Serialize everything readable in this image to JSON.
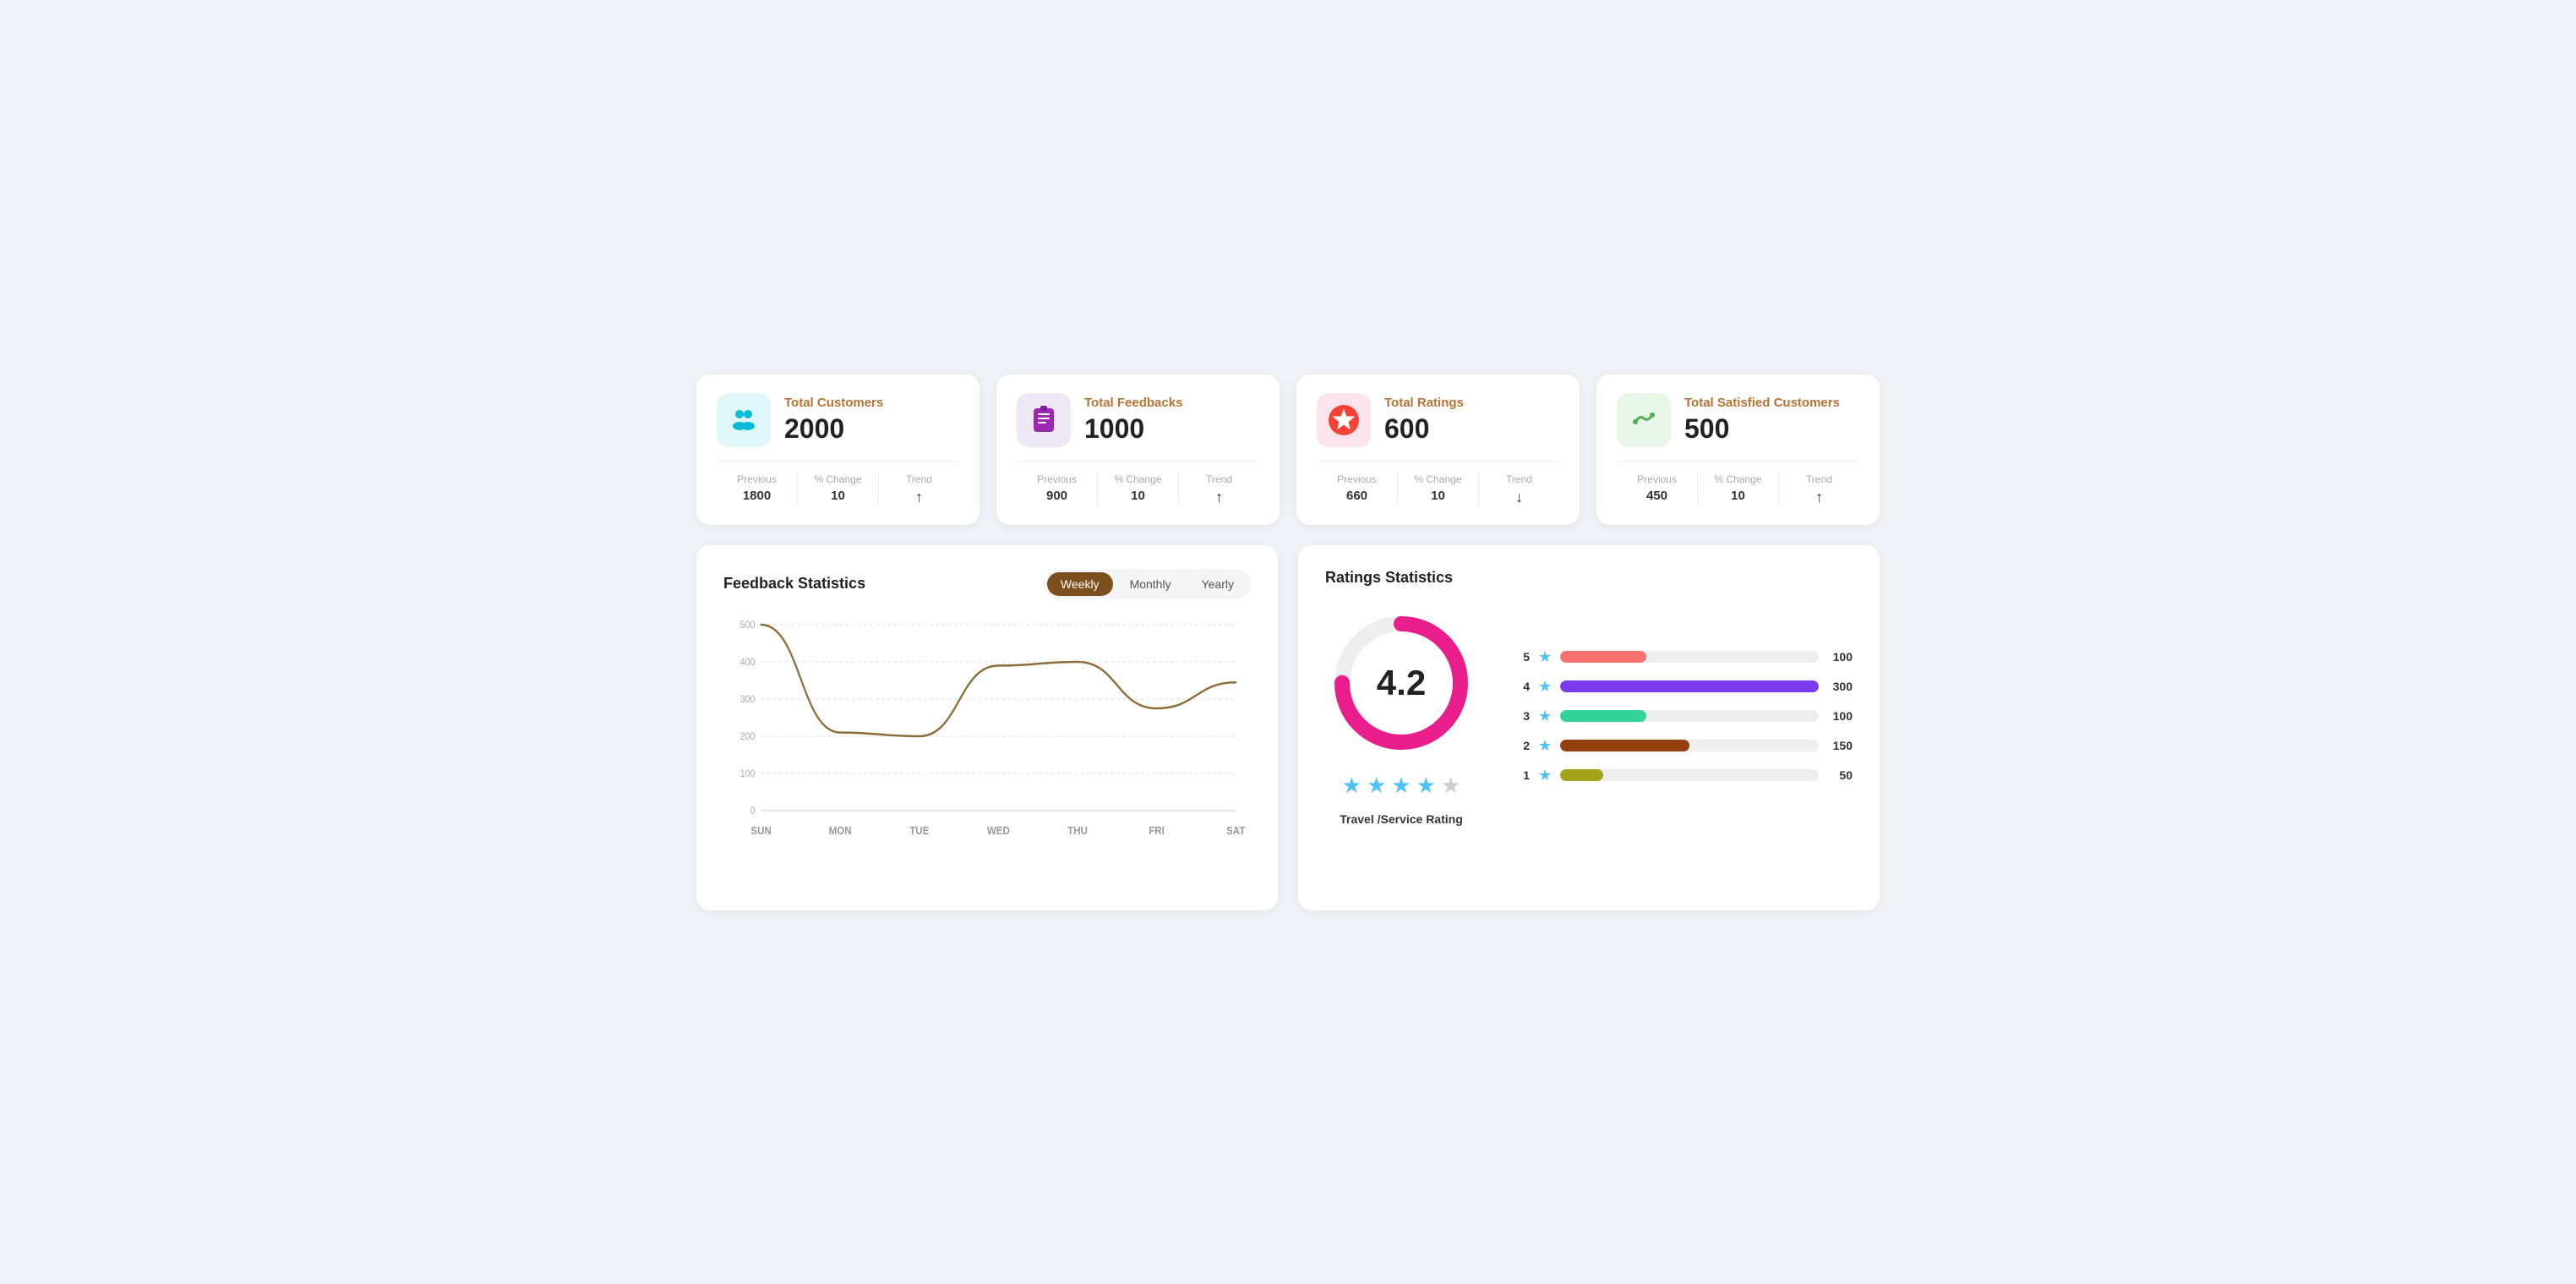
{
  "cards": [
    {
      "id": "total-customers",
      "label": "Total Customers",
      "value": "2000",
      "icon": "👥",
      "iconClass": "icon-cyan",
      "previous": "1800",
      "change": "10",
      "trend": "up"
    },
    {
      "id": "total-feedbacks",
      "label": "Total Feedbacks",
      "value": "1000",
      "icon": "📋",
      "iconClass": "icon-purple",
      "previous": "900",
      "change": "10",
      "trend": "up"
    },
    {
      "id": "total-ratings",
      "label": "Total Ratings",
      "value": "600",
      "icon": "⭐",
      "iconClass": "icon-pink",
      "previous": "660",
      "change": "10",
      "trend": "down"
    },
    {
      "id": "total-satisfied",
      "label": "Total Satisfied Customers",
      "value": "500",
      "icon": "🤝",
      "iconClass": "icon-green",
      "previous": "450",
      "change": "10",
      "trend": "up"
    }
  ],
  "feedback_chart": {
    "title": "Feedback  Statistics",
    "tabs": [
      "Weekly",
      "Monthly",
      "Yearly"
    ],
    "active_tab": "Weekly",
    "days": [
      "SUN",
      "MON",
      "TUE",
      "WED",
      "THU",
      "FRI",
      "SAT"
    ],
    "y_labels": [
      "0",
      "100",
      "200",
      "300",
      "400",
      "500"
    ],
    "data_points": [
      500,
      210,
      200,
      390,
      400,
      275,
      345
    ]
  },
  "ratings_chart": {
    "title": "Ratings Statistics",
    "score": "4.2",
    "stars_filled": 4,
    "stars_total": 5,
    "service_label": "Travel /Service Rating",
    "bars": [
      {
        "label": "5",
        "count": 100,
        "max": 300,
        "color": "#f87171"
      },
      {
        "label": "4",
        "count": 300,
        "max": 300,
        "color": "#7c3aed"
      },
      {
        "label": "3",
        "count": 100,
        "max": 300,
        "color": "#34d399"
      },
      {
        "label": "2",
        "count": 150,
        "max": 300,
        "color": "#92400e"
      },
      {
        "label": "1",
        "count": 50,
        "max": 300,
        "color": "#a3a31a"
      }
    ]
  }
}
